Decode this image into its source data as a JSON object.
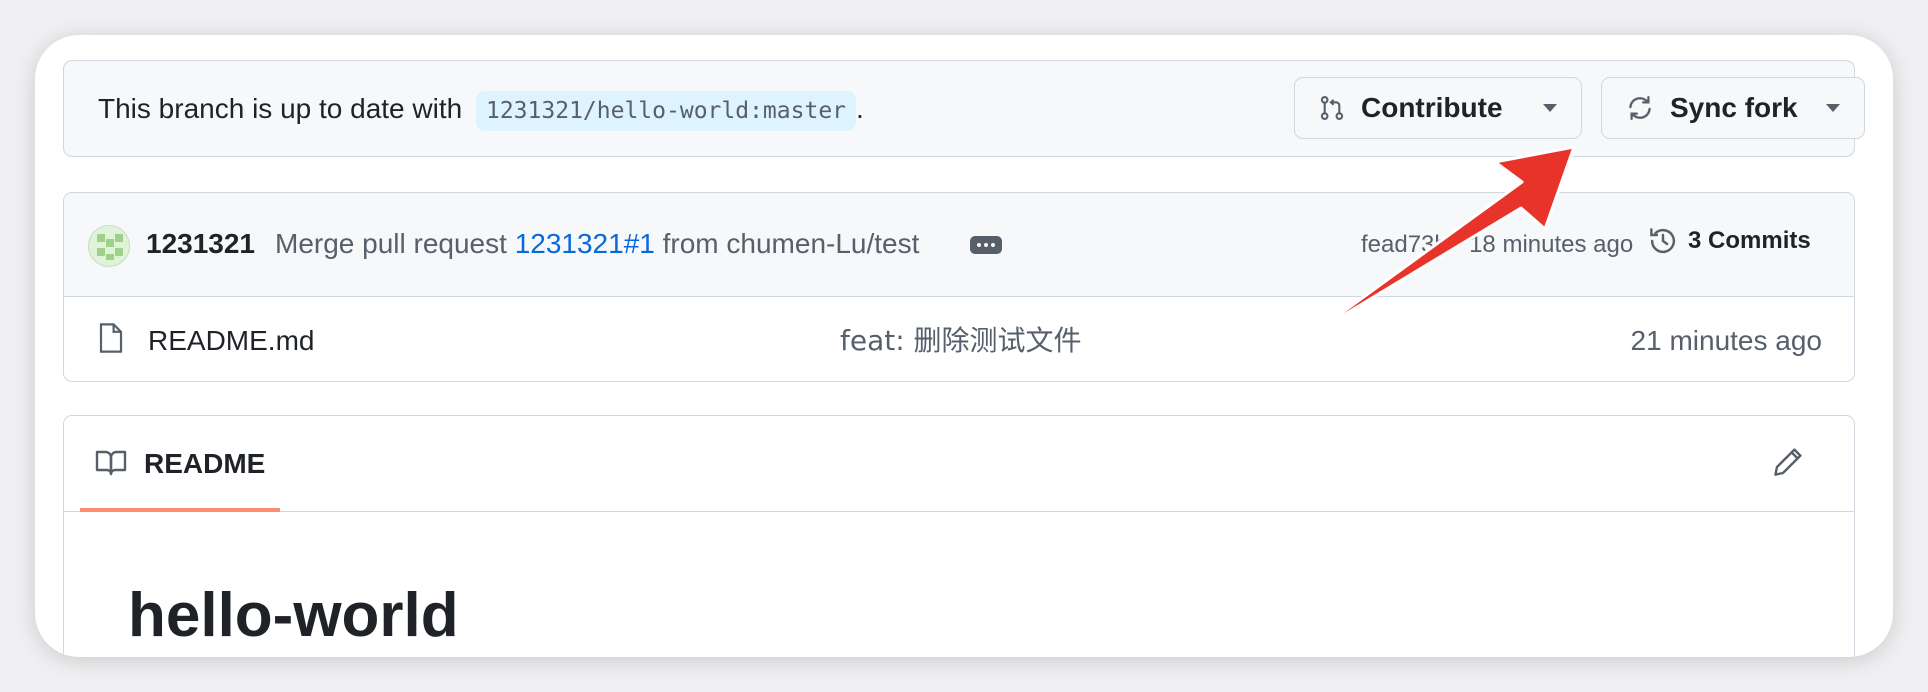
{
  "branch_status": {
    "prefix": "This branch is up to date with",
    "ref": "1231321/hello-world:master",
    "suffix": "."
  },
  "buttons": {
    "contribute": "Contribute",
    "sync_fork": "Sync fork"
  },
  "latest_commit": {
    "author": "1231321",
    "message_prefix": "Merge pull request",
    "pr_link": "1231321#1",
    "message_suffix": "from chumen-Lu/test",
    "meta": "fead73b · 18 minutes ago",
    "commits_count_label": "3 Commits"
  },
  "files": [
    {
      "name": "README.md",
      "last_commit": "feat: 删除测试文件",
      "updated": "21 minutes ago"
    }
  ],
  "readme": {
    "tab_label": "README",
    "heading": "hello-world"
  },
  "colors": {
    "accent_link": "#0969da",
    "tab_underline": "#fd8c73",
    "annotation_arrow": "#e8332a"
  },
  "icons": [
    "git-pull-request-icon",
    "sync-icon",
    "triangle-down-icon",
    "history-icon",
    "file-icon",
    "book-icon",
    "pencil-icon",
    "kebab-horizontal-icon"
  ]
}
